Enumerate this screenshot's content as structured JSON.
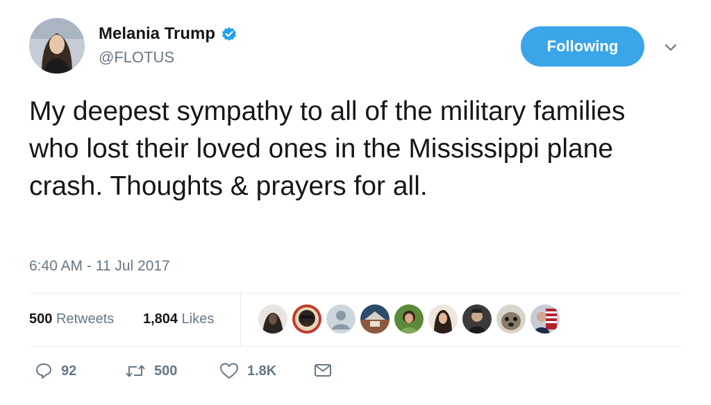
{
  "user": {
    "display_name": "Melania Trump",
    "handle": "@FLOTUS",
    "verified_icon": "verified-badge-icon",
    "avatar_icon": "profile-photo"
  },
  "follow_button": {
    "label": "Following"
  },
  "menu": {
    "icon": "chevron-down-icon"
  },
  "tweet": {
    "text": "My deepest sympathy to all of the military families who lost their loved ones in the Mississippi plane crash. Thoughts & prayers for all.",
    "timestamp": "6:40 AM - 11 Jul 2017"
  },
  "stats": {
    "retweets_count": "500",
    "retweets_label": "Retweets",
    "likes_count": "1,804",
    "likes_label": "Likes"
  },
  "likers": [
    {
      "icon": "liker-avatar-1"
    },
    {
      "icon": "liker-avatar-2"
    },
    {
      "icon": "default-avatar-icon"
    },
    {
      "icon": "liker-avatar-4"
    },
    {
      "icon": "liker-avatar-5"
    },
    {
      "icon": "liker-avatar-6"
    },
    {
      "icon": "liker-avatar-7"
    },
    {
      "icon": "liker-avatar-8"
    },
    {
      "icon": "liker-avatar-9"
    }
  ],
  "actions": {
    "reply_count": "92",
    "retweet_count": "500",
    "like_count": "1.8K"
  },
  "colors": {
    "accent": "#3aa5e8",
    "verified": "#1da1f2",
    "muted_text": "#657786",
    "divider": "#e6ecf0"
  }
}
